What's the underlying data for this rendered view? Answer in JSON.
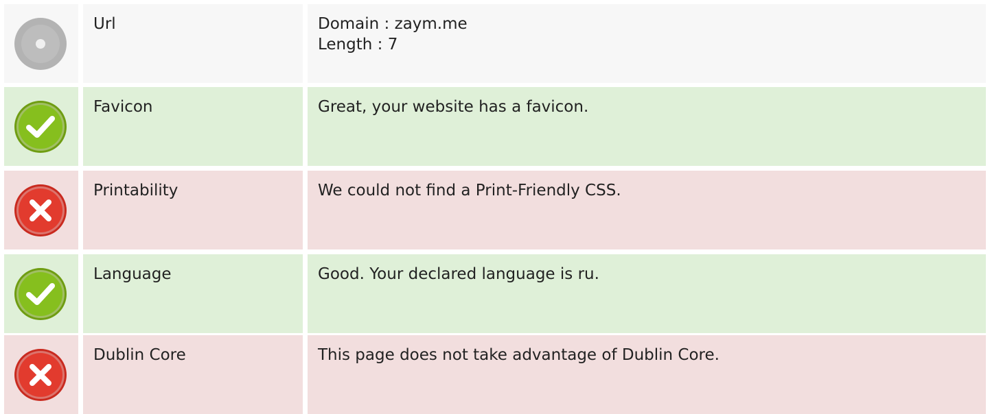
{
  "rows": [
    {
      "status": "neutral",
      "icon": "neutral-disc-icon",
      "label": "Url",
      "lines": [
        "Domain : zaym.me",
        "Length : 7"
      ]
    },
    {
      "status": "pass",
      "icon": "checkmark-icon",
      "label": "Favicon",
      "lines": [
        "Great, your website has a favicon."
      ]
    },
    {
      "status": "fail",
      "icon": "error-x-icon",
      "label": "Printability",
      "lines": [
        "We could not find a Print-Friendly CSS."
      ]
    },
    {
      "status": "pass",
      "icon": "checkmark-icon",
      "label": "Language",
      "lines": [
        "Good. Your declared language is ru."
      ]
    },
    {
      "status": "fail",
      "icon": "error-x-icon",
      "label": "Dublin Core",
      "lines": [
        "This page does not take advantage of Dublin Core."
      ]
    }
  ],
  "colors": {
    "neutral_bg": "#f7f7f7",
    "pass_bg": "#dff0d8",
    "fail_bg": "#f2dede",
    "pass_icon": "#86bf1e",
    "fail_icon": "#e23b2e",
    "neutral_icon": "#b3b3b3"
  }
}
